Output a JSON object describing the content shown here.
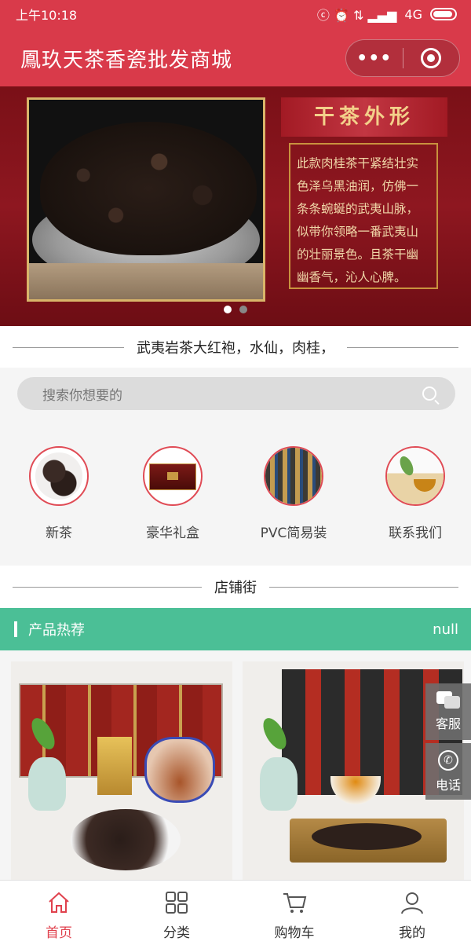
{
  "status_bar": {
    "time": "上午10:18",
    "network": "4G",
    "signal_glyphs": "ⓒ ⏰ ⇅ ▂▄▆"
  },
  "nav": {
    "title": "鳳玖天茶香瓷批发商城",
    "more_glyph": "•••"
  },
  "banner": {
    "heading": "干茶外形",
    "text": "此款肉桂茶干紧结壮实色泽乌黑油润，仿佛一条条蜿蜒的武夷山脉，似带你领略一番武夷山的壮丽景色。且茶干幽幽香气，沁人心脾。",
    "slides": 2,
    "active_slide": 1
  },
  "subtitle": "武夷岩茶大红袍，水仙，肉桂，",
  "search": {
    "placeholder": "搜索你想要的"
  },
  "categories": [
    {
      "label": "新茶",
      "icon": "new-tea-image"
    },
    {
      "label": "豪华礼盒",
      "icon": "gift-box-image"
    },
    {
      "label": "PVC简易装",
      "icon": "pvc-pack-image"
    },
    {
      "label": "联系我们",
      "icon": "contact-us-image"
    }
  ],
  "shop_street": "店铺街",
  "products_section": {
    "title": "产品热荐",
    "more": "null"
  },
  "float_buttons": {
    "service": "客服",
    "phone": "电话"
  },
  "tabbar": {
    "items": [
      {
        "label": "首页",
        "icon": "home-icon",
        "active": true
      },
      {
        "label": "分类",
        "icon": "category-icon",
        "active": false
      },
      {
        "label": "购物车",
        "icon": "cart-icon",
        "active": false
      },
      {
        "label": "我的",
        "icon": "user-icon",
        "active": false
      }
    ],
    "active_color": "#e0414d"
  },
  "colors": {
    "nav_bg": "#d93a4a",
    "section_green": "#4bbf96",
    "category_ring": "#e04b55"
  }
}
